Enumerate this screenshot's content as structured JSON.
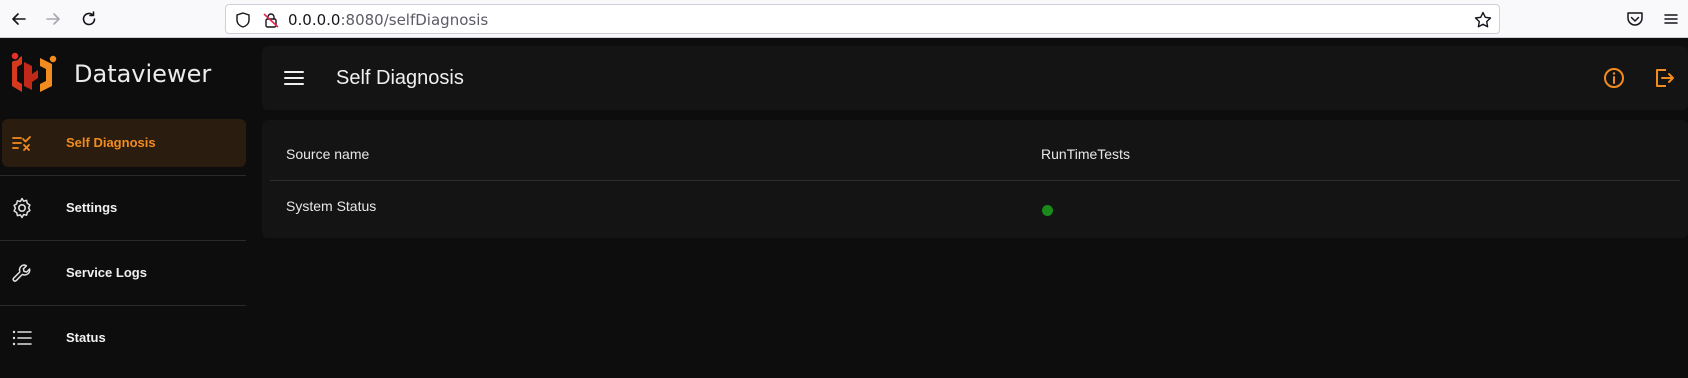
{
  "browser": {
    "url_host": "0.0.0.0",
    "url_path": ":8080/selfDiagnosis"
  },
  "app": {
    "brand_name": "Dataviewer",
    "accent_color": "#f28c1e"
  },
  "sidebar": {
    "items": [
      {
        "label": "Self Diagnosis",
        "icon": "checklist-icon",
        "active": true
      },
      {
        "label": "Settings",
        "icon": "gear-icon",
        "active": false
      },
      {
        "label": "Service Logs",
        "icon": "wrench-icon",
        "active": false
      },
      {
        "label": "Status",
        "icon": "list-icon",
        "active": false
      }
    ]
  },
  "header": {
    "title": "Self Diagnosis"
  },
  "table": {
    "columns": [
      "Source name",
      "RunTimeTests"
    ],
    "rows": [
      {
        "source_name": "System Status",
        "status_color": "#1a8a1a"
      }
    ]
  }
}
